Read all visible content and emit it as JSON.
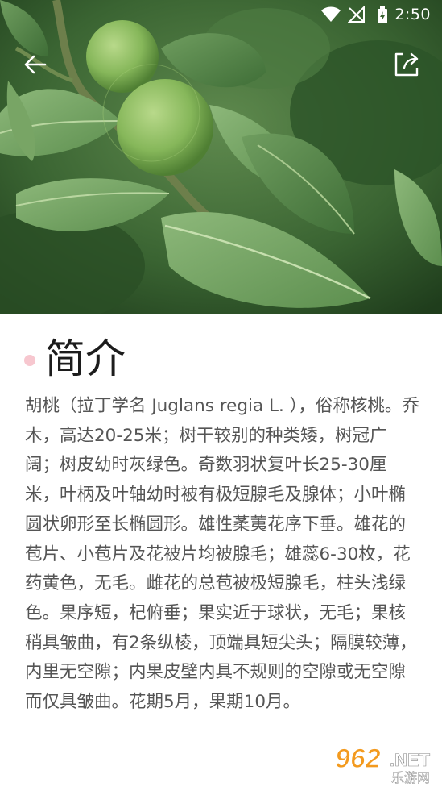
{
  "status_bar": {
    "time": "2:50",
    "icons": [
      "wifi-icon",
      "no-signal-icon",
      "battery-charging-icon"
    ]
  },
  "toolbar": {
    "back_icon": "arrow-left-icon",
    "share_icon": "share-icon"
  },
  "article": {
    "section_title": "简介",
    "body": "胡桃（拉丁学名 Juglans regia L. ），俗称核桃。乔木，高达20-25米；树干较别的种类矮，树冠广阔；树皮幼时灰绿色。奇数羽状复叶长25-30厘米，叶柄及叶轴幼时被有极短腺毛及腺体；小叶椭圆状卵形至长椭圆形。雄性葇荑花序下垂。雄花的苞片、小苞片及花被片均被腺毛；雄蕊6-30枚，花药黄色，无毛。雌花的总苞被极短腺毛，柱头浅绿色。果序短，杞俯垂；果实近于球状，无毛；果核稍具皱曲，有2条纵棱，顶端具短尖头；隔膜较薄，内里无空隙；内果皮壁内具不规则的空隙或无空隙而仅具皱曲。花期5月，果期10月。"
  },
  "watermark": {
    "number": "962",
    "suffix": ".NET",
    "subtitle": "乐游网"
  },
  "colors": {
    "title_dot": "#f7c7cf",
    "body_text": "#555555",
    "title_text": "#1c1c1c",
    "watermark_orange": "#f39a1e"
  }
}
